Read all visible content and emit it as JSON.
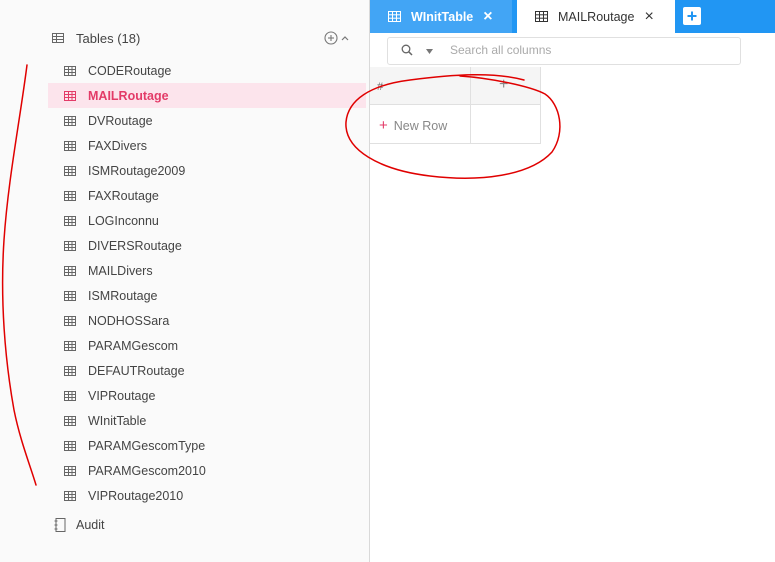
{
  "sidebar": {
    "tables_header": "Tables (18)",
    "tables": [
      {
        "label": "CODERoutage",
        "active": false
      },
      {
        "label": "MAILRoutage",
        "active": true
      },
      {
        "label": "DVRoutage",
        "active": false
      },
      {
        "label": "FAXDivers",
        "active": false
      },
      {
        "label": "ISMRoutage2009",
        "active": false
      },
      {
        "label": "FAXRoutage",
        "active": false
      },
      {
        "label": "LOGInconnu",
        "active": false
      },
      {
        "label": "DIVERSRoutage",
        "active": false
      },
      {
        "label": "MAILDivers",
        "active": false
      },
      {
        "label": "ISMRoutage",
        "active": false
      },
      {
        "label": "NODHOSSara",
        "active": false
      },
      {
        "label": "PARAMGescom",
        "active": false
      },
      {
        "label": "DEFAUTRoutage",
        "active": false
      },
      {
        "label": "VIPRoutage",
        "active": false
      },
      {
        "label": "WInitTable",
        "active": false
      },
      {
        "label": "PARAMGescomType",
        "active": false
      },
      {
        "label": "PARAMGescom2010",
        "active": false
      },
      {
        "label": "VIPRoutage2010",
        "active": false
      }
    ],
    "audit_label": "Audit"
  },
  "tabs": [
    {
      "label": "WInitTable",
      "icon": "table-icon"
    },
    {
      "label": "MAILRoutage",
      "icon": "table-icon"
    }
  ],
  "search": {
    "placeholder": "Search all columns",
    "value": ""
  },
  "grid": {
    "index_header": "#",
    "new_row_label": "New Row"
  },
  "colors": {
    "tabbar": "#2196f3",
    "tab_active_blue": "#42a5f5",
    "accent_pink": "#e33b68",
    "active_row_bg": "#fce4ec",
    "annotation_red": "#e00000"
  },
  "icons": {
    "add_table": "add-circle-icon",
    "collapse": "chevron-up-icon",
    "search": "search-icon",
    "dropdown": "caret-down-icon",
    "audit": "notebook-icon"
  }
}
